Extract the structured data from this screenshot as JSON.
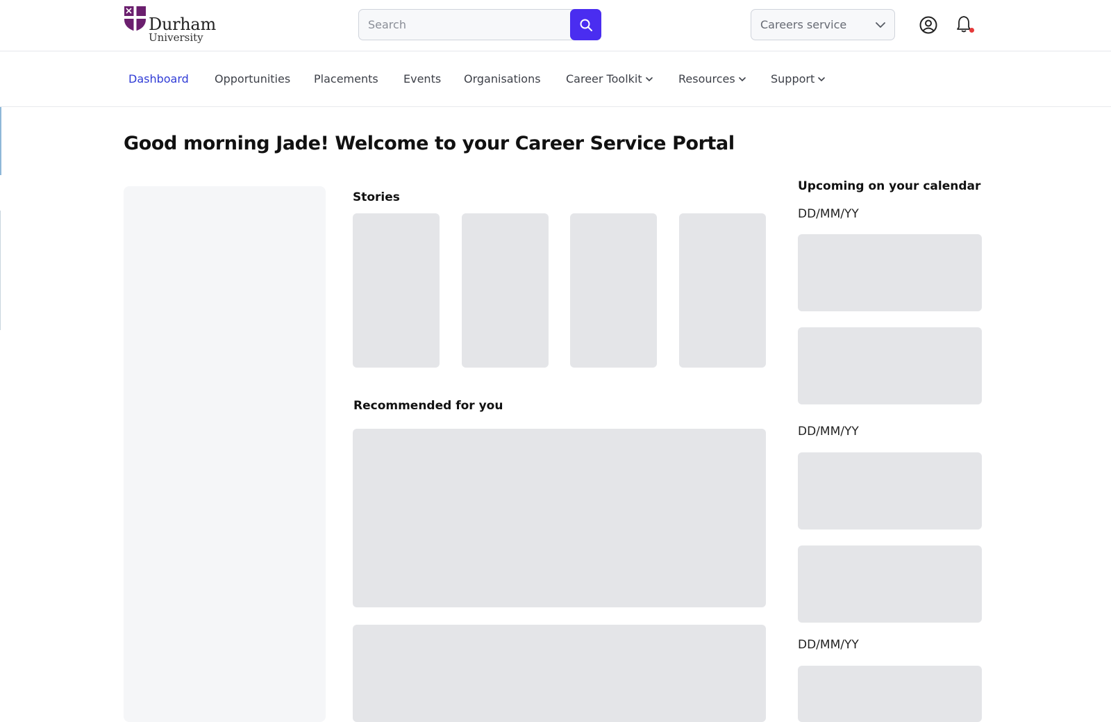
{
  "header": {
    "logo": {
      "name": "Durham",
      "sub": "University",
      "brand_color": "#6b1f6e"
    },
    "search": {
      "placeholder": "Search",
      "value": "",
      "button_color": "#4a2df0",
      "icon": "search-icon"
    },
    "service_select": {
      "selected": "Careers service",
      "icon": "chevron-down-icon"
    },
    "profile_icon": "user-circle-icon",
    "notifications": {
      "icon": "bell-icon",
      "has_unread": true,
      "dot_color": "#e53a3a"
    }
  },
  "nav": {
    "active_color": "#2f3bd6",
    "items": [
      {
        "label": "Dashboard",
        "active": true,
        "dropdown": false
      },
      {
        "label": "Opportunities",
        "active": false,
        "dropdown": false
      },
      {
        "label": "Placements",
        "active": false,
        "dropdown": false
      },
      {
        "label": "Events",
        "active": false,
        "dropdown": false
      },
      {
        "label": "Organisations",
        "active": false,
        "dropdown": false
      },
      {
        "label": "Career Toolkit",
        "active": false,
        "dropdown": true
      },
      {
        "label": "Resources",
        "active": false,
        "dropdown": true
      },
      {
        "label": "Support",
        "active": false,
        "dropdown": true
      }
    ]
  },
  "main": {
    "greeting": "Good morning Jade! Welcome to your Career Service Portal",
    "stories": {
      "title": "Stories"
    },
    "recommended": {
      "title": "Recommended for you"
    }
  },
  "calendar": {
    "title": "Upcoming on your calendar",
    "groups": [
      {
        "date": "DD/MM/YY"
      },
      {
        "date": "DD/MM/YY"
      },
      {
        "date": "DD/MM/YY"
      }
    ]
  }
}
